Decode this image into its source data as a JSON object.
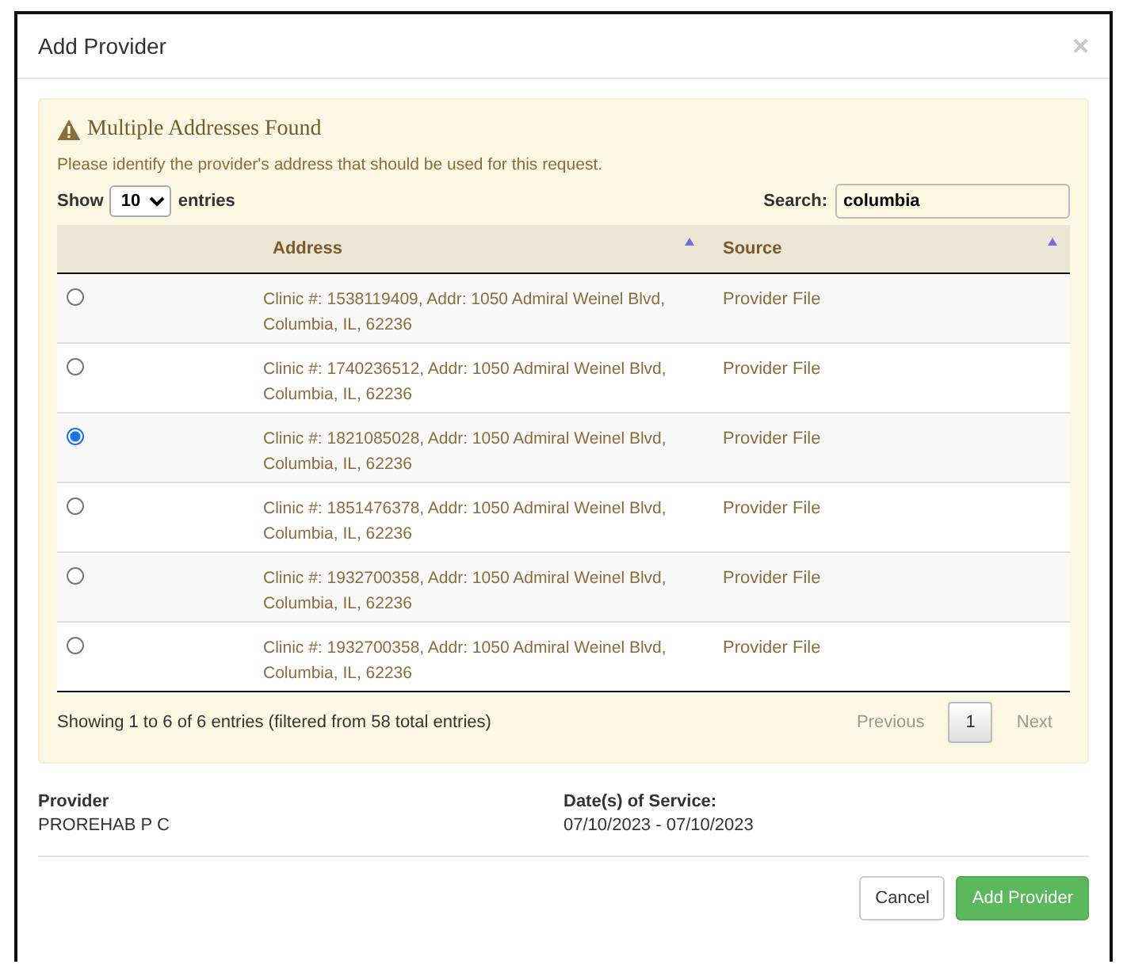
{
  "dialog": {
    "title": "Add Provider",
    "close": "×"
  },
  "alert": {
    "title": "Multiple Addresses Found",
    "message": "Please identify the provider's address that should be used for this request."
  },
  "length": {
    "label_before": "Show",
    "value": "10",
    "label_after": "entries"
  },
  "search": {
    "label": "Search:",
    "value": "columbia"
  },
  "table": {
    "columns": [
      "Address",
      "Source"
    ],
    "rows": [
      {
        "address": "Clinic #: 1538119409, Addr: 1050 Admiral Weinel Blvd, Columbia, IL, 62236",
        "source": "Provider File",
        "selected": false
      },
      {
        "address": "Clinic #: 1740236512, Addr: 1050 Admiral Weinel Blvd, Columbia, IL, 62236",
        "source": "Provider File",
        "selected": false
      },
      {
        "address": "Clinic #: 1821085028, Addr: 1050 Admiral Weinel Blvd, Columbia, IL, 62236",
        "source": "Provider File",
        "selected": true
      },
      {
        "address": "Clinic #: 1851476378, Addr: 1050 Admiral Weinel Blvd, Columbia, IL, 62236",
        "source": "Provider File",
        "selected": false
      },
      {
        "address": "Clinic #: 1932700358, Addr: 1050 Admiral Weinel Blvd, Columbia, IL, 62236",
        "source": "Provider File",
        "selected": false
      },
      {
        "address": "Clinic #: 1932700358, Addr: 1050 Admiral Weinel Blvd, Columbia, IL, 62236",
        "source": "Provider File",
        "selected": false
      }
    ]
  },
  "info": "Showing 1 to 6 of 6 entries (filtered from 58 total entries)",
  "pagination": [
    {
      "label": "Previous",
      "kind": "nav"
    },
    {
      "label": "1",
      "kind": "page"
    },
    {
      "label": "Next",
      "kind": "nav"
    }
  ],
  "details": [
    {
      "label": "Provider",
      "value": "PROREHAB P C"
    },
    {
      "label": "Date(s) of Service:",
      "value": "07/10/2023 - 07/10/2023"
    }
  ],
  "buttons": [
    {
      "label": "Cancel",
      "kind": "default"
    },
    {
      "label": "Add Provider",
      "kind": "primary"
    }
  ]
}
